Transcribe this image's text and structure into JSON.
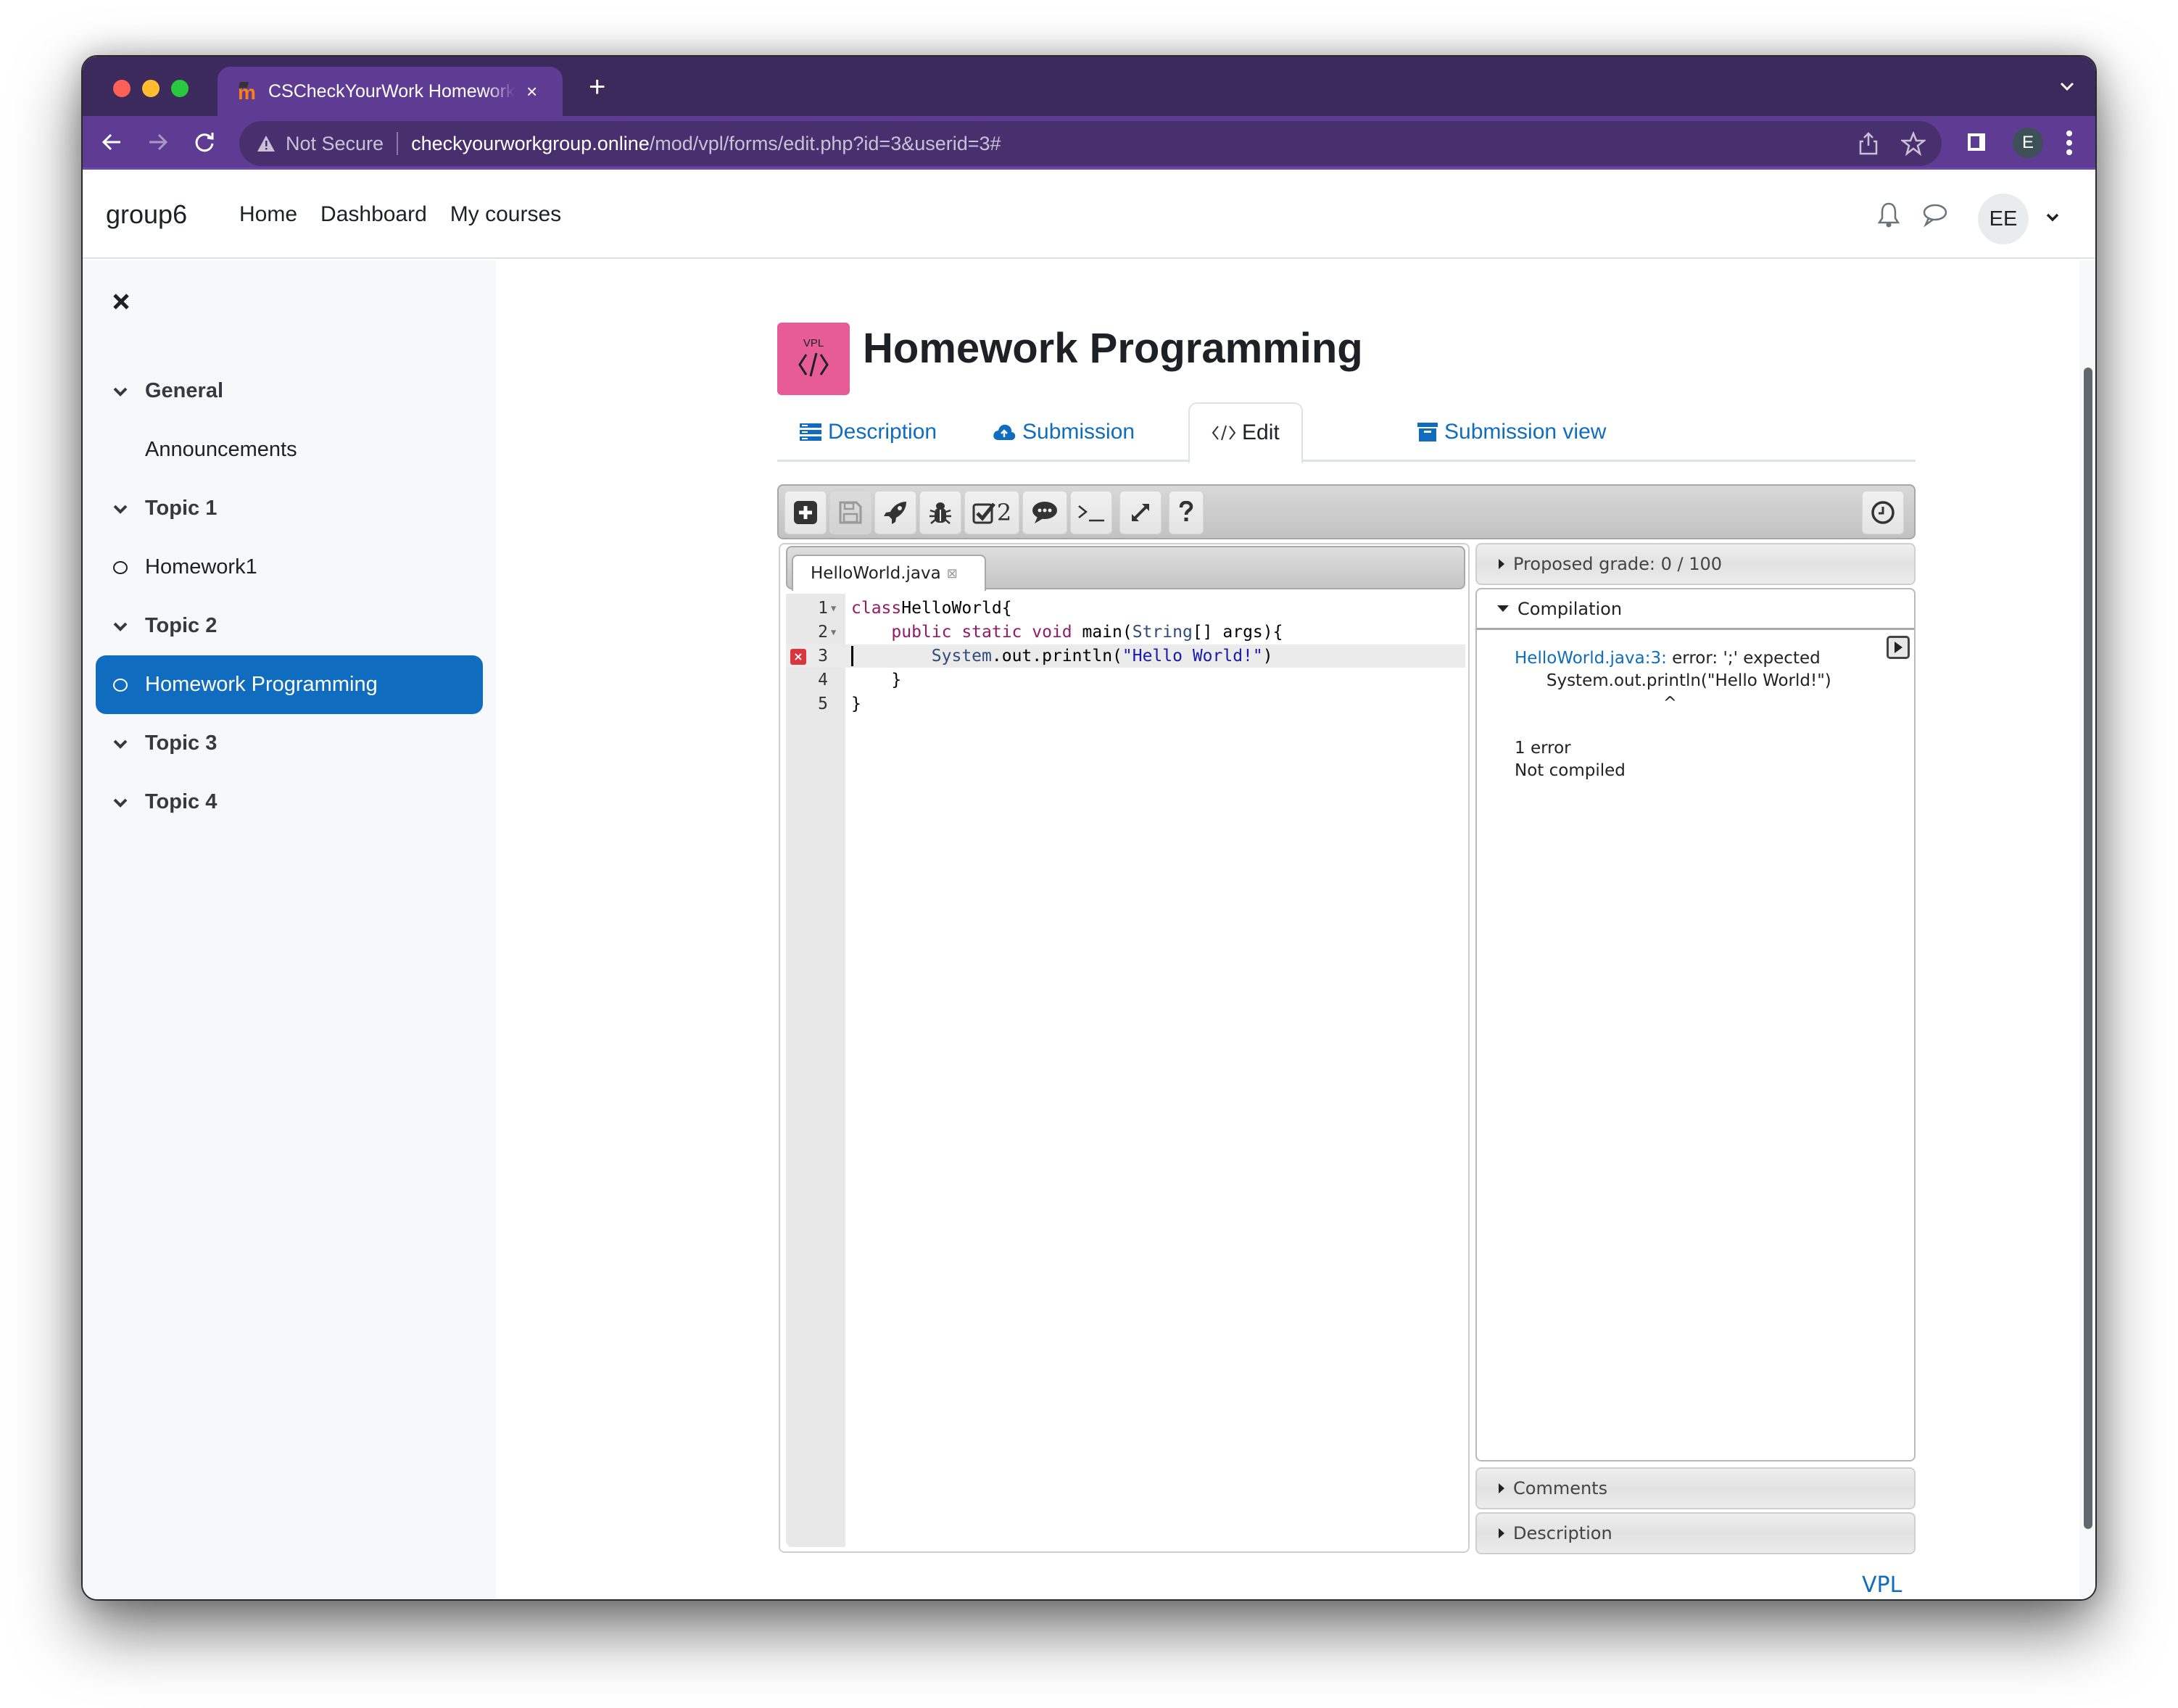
{
  "browser": {
    "tab_title": "CSCheckYourWork Homework",
    "tab_close": "×",
    "new_tab": "+",
    "security_label": "Not Secure",
    "url_host": "checkyourworkgroup.online",
    "url_path": "/mod/vpl/forms/edit.php?id=3&userid=3#",
    "profile_initial": "E"
  },
  "header": {
    "site_name": "group6",
    "nav": [
      "Home",
      "Dashboard",
      "My courses"
    ],
    "user_initials": "EE"
  },
  "sidebar": {
    "items": [
      {
        "label": "General",
        "type": "section"
      },
      {
        "label": "Announcements",
        "type": "activity"
      },
      {
        "label": "Topic 1",
        "type": "section"
      },
      {
        "label": "Homework1",
        "type": "activity"
      },
      {
        "label": "Topic 2",
        "type": "section"
      },
      {
        "label": "Homework Programming",
        "type": "activity",
        "active": true
      },
      {
        "label": "Topic 3",
        "type": "section"
      },
      {
        "label": "Topic 4",
        "type": "section"
      }
    ]
  },
  "page": {
    "icon_label": "VPL",
    "title": "Homework Programming",
    "tabs": [
      {
        "label": "Description",
        "icon": "description-icon"
      },
      {
        "label": "Submission",
        "icon": "cloud-upload-icon"
      },
      {
        "label": "Edit",
        "icon": "code-icon",
        "active": true
      },
      {
        "label": "Submission view",
        "icon": "archive-icon"
      }
    ]
  },
  "ide": {
    "toolbar": {
      "buttons": [
        "new-file",
        "save",
        "run",
        "debug",
        "evaluate",
        "comments",
        "console",
        "fullscreen",
        "help"
      ],
      "evaluate_count": "2",
      "console_label": ">_",
      "help_label": "?"
    },
    "file_tab": {
      "name": "HelloWorld.java",
      "close": "⊠"
    },
    "code": {
      "error_line": 3,
      "cursor_line": 3,
      "lines": [
        {
          "n": "1",
          "fold": true,
          "tokens": [
            [
              "kw",
              "class"
            ],
            [
              "",
              "HelloWorld{"
            ]
          ]
        },
        {
          "n": "2",
          "fold": true,
          "tokens": [
            [
              "",
              "    "
            ],
            [
              "kw",
              "public static void"
            ],
            [
              "",
              " main("
            ],
            [
              "ty",
              "String"
            ],
            [
              "",
              "[] args){"
            ]
          ]
        },
        {
          "n": "3",
          "fold": false,
          "tokens": [
            [
              "",
              "        "
            ],
            [
              "ty",
              "System"
            ],
            [
              "",
              ".out.println("
            ],
            [
              "str",
              "\"Hello World!\""
            ],
            [
              "",
              ")"
            ]
          ]
        },
        {
          "n": "4",
          "fold": false,
          "tokens": [
            [
              "",
              "    }"
            ]
          ]
        },
        {
          "n": "5",
          "fold": false,
          "tokens": [
            [
              "",
              "}"
            ]
          ]
        }
      ]
    },
    "results": {
      "proposed_grade": "Proposed grade: 0 / 100",
      "compilation_title": "Compilation",
      "compilation": {
        "error_link": "HelloWorld.java:3:",
        "error_text": " error: ';' expected",
        "source_line": "      System.out.println(\"Hello World!\")",
        "caret_line": "                            ^",
        "summary": "1 error",
        "status": "Not compiled"
      },
      "comments_title": "Comments",
      "description_title": "Description"
    }
  },
  "footer": {
    "vpl_link": "VPL",
    "help_label": "?"
  },
  "colors": {
    "brand_blue": "#0f6cbf",
    "vpl_pink": "#e75b97",
    "chrome_purple": "#5f3c93",
    "error_red": "#d9363e"
  }
}
